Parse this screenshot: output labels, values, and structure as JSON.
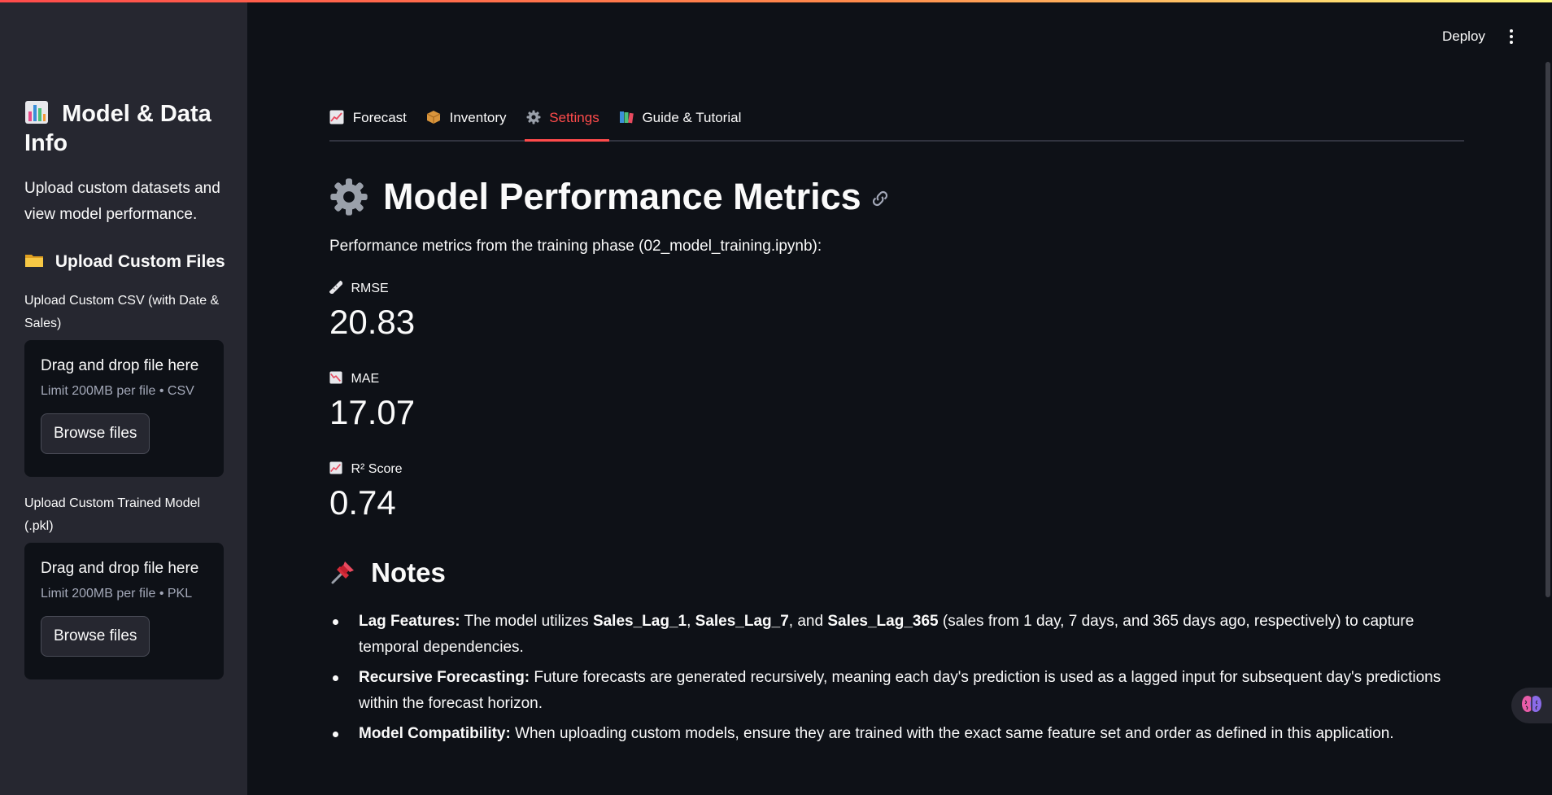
{
  "sidebar": {
    "title_icon": "bar-chart-emoji",
    "title": "Model & Data Info",
    "description": "Upload custom datasets and view model performance.",
    "upload_section": {
      "icon": "folder-emoji",
      "heading": "Upload Custom Files"
    },
    "uploaders": [
      {
        "label": "Upload Custom CSV (with Date & Sales)",
        "drop_text": "Drag and drop file here",
        "limit_text": "Limit 200MB per file • CSV",
        "button": "Browse files"
      },
      {
        "label": "Upload Custom Trained Model (.pkl)",
        "drop_text": "Drag and drop file here",
        "limit_text": "Limit 200MB per file • PKL",
        "button": "Browse files"
      }
    ]
  },
  "header": {
    "deploy": "Deploy",
    "menu_icon": "kebab-menu-icon"
  },
  "tabs": [
    {
      "icon": "chart-up-emoji",
      "label": "Forecast",
      "active": false
    },
    {
      "icon": "package-emoji",
      "label": "Inventory",
      "active": false
    },
    {
      "icon": "gear-emoji",
      "label": "Settings",
      "active": true
    },
    {
      "icon": "books-emoji",
      "label": "Guide & Tutorial",
      "active": false
    }
  ],
  "main": {
    "title_icon": "gear-emoji",
    "title": "Model Performance Metrics",
    "description": "Performance metrics from the training phase (02_model_training.ipynb):",
    "metrics": [
      {
        "icon": "ruler-emoji",
        "label": "RMSE",
        "value": "20.83"
      },
      {
        "icon": "chart-down-emoji",
        "label": "MAE",
        "value": "17.07"
      },
      {
        "icon": "chart-up-emoji",
        "label": "R² Score",
        "value": "0.74"
      }
    ],
    "notes_icon": "pushpin-emoji",
    "notes_title": "Notes",
    "notes": [
      {
        "title": "Lag Features:",
        "t1": " The model utilizes ",
        "b1": "Sales_Lag_1",
        "t2": ", ",
        "b2": "Sales_Lag_7",
        "t3": ", and ",
        "b3": "Sales_Lag_365",
        "t4": " (sales from 1 day, 7 days, and 365 days ago, respectively) to capture temporal dependencies."
      },
      {
        "title": "Recursive Forecasting:",
        "text": " Future forecasts are generated recursively, meaning each day's prediction is used as a lagged input for subsequent day's predictions within the forecast horizon."
      },
      {
        "title": "Model Compatibility:",
        "text": " When uploading custom models, ensure they are trained with the exact same feature set and order as defined in this application."
      }
    ]
  },
  "colors": {
    "accent": "#ff4b4b",
    "background": "#0e1117",
    "sidebar": "#262730",
    "text": "#fafafa"
  }
}
